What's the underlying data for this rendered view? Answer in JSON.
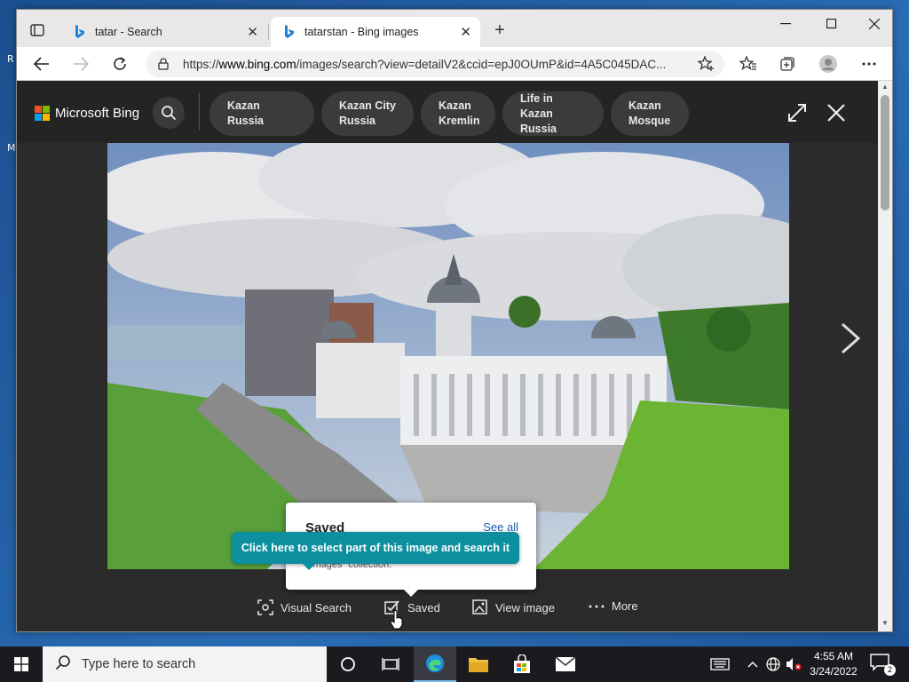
{
  "desktop": {
    "fragment1": "R",
    "fragment2": "M"
  },
  "browser": {
    "tabs": [
      {
        "title": "tatar - Search",
        "active": false
      },
      {
        "title": "tatarstan - Bing images",
        "active": true
      }
    ],
    "address": {
      "protocol": "https://",
      "domain": "www.bing.com",
      "path": "/images/search?view=detailV2&ccid=epJ0OUmP&id=4A5C045DAC..."
    }
  },
  "bing": {
    "logo": "Microsoft Bing",
    "chips": [
      {
        "line1": "Kazan Russia",
        "line2": ""
      },
      {
        "line1": "Kazan City",
        "line2": "Russia"
      },
      {
        "line1": "Kazan",
        "line2": "Kremlin"
      },
      {
        "line1": "Life in Kazan",
        "line2": "Russia"
      },
      {
        "line1": "Kazan",
        "line2": "Mosque"
      }
    ],
    "actions": {
      "visual_search": "Visual Search",
      "saved": "Saved",
      "view_image": "View image",
      "more": "More"
    },
    "popup": {
      "title": "Saved",
      "see_all": "See all",
      "text": "images\" collection."
    },
    "tooltip": "Click here to select part of this image and search it"
  },
  "taskbar": {
    "search_placeholder": "Type here to search",
    "time": "4:55 AM",
    "date": "3/24/2022",
    "notification_count": "2"
  },
  "colors": {
    "bing_bg": "#2b2b2b",
    "tooltip": "#0d8fa0",
    "link": "#1a5fb4",
    "taskbar": "#1b1b1f"
  }
}
